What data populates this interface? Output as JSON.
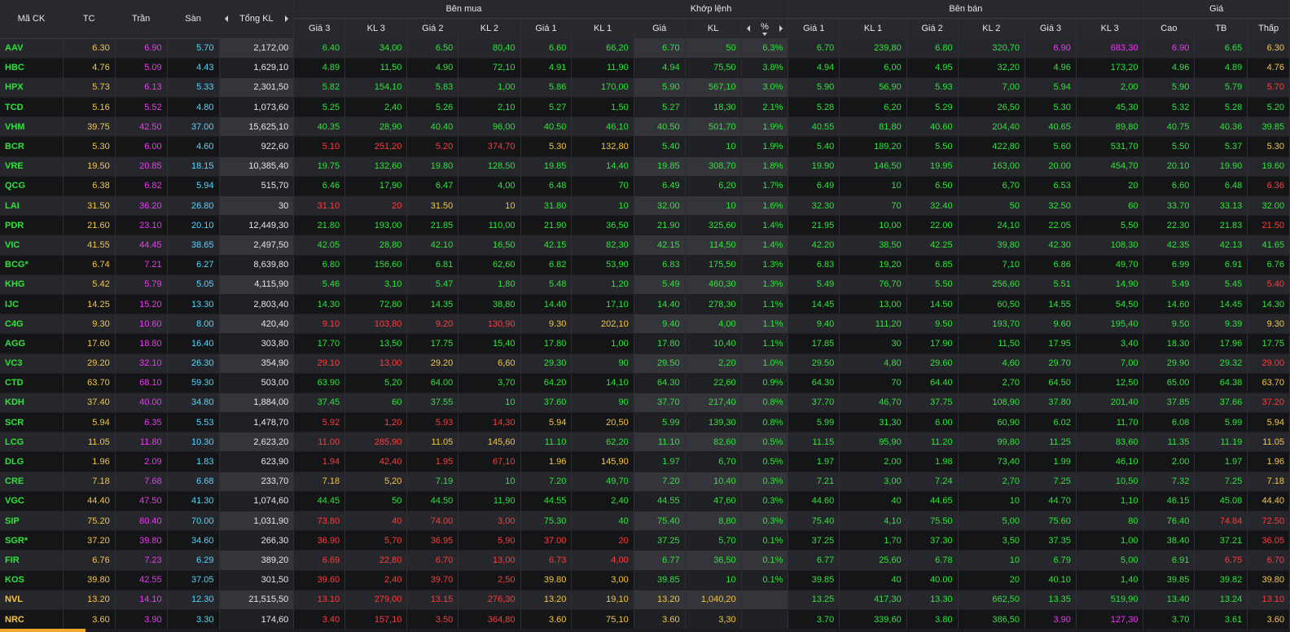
{
  "header": {
    "symbol": "Mã CK",
    "ref": "TC",
    "ceil": "Trần",
    "floor": "Sàn",
    "total_vol": "Tổng KL",
    "buy_group": "Bên mua",
    "match_group": "Khớp lệnh",
    "sell_group": "Bên bán",
    "price_group": "Giá",
    "buy_cols": [
      "Giá 3",
      "KL 3",
      "Giá 2",
      "KL 2",
      "Giá 1",
      "KL 1"
    ],
    "match_cols": [
      "Giá",
      "KL",
      "%"
    ],
    "sell_cols": [
      "Giá 1",
      "KL 1",
      "Giá 2",
      "KL 2",
      "Giá 3",
      "KL 3"
    ],
    "price_cols": [
      "Cao",
      "TB",
      "Thấp"
    ]
  },
  "colors": {
    "up": "#2fe33a",
    "ref": "#f5c542",
    "down": "#ff3b3b",
    "ceiling": "#f037f5",
    "floor": "#4fd6ff",
    "accent": "#f0a830"
  },
  "rows": [
    {
      "symbol": "AAV",
      "ref": "6.30",
      "ceil": "6.90",
      "floor": "5.70",
      "total_vol": "2,172,00",
      "b3p": "6.40",
      "b3v": "34,00",
      "b2p": "6.50",
      "b2v": "80,40",
      "b1p": "6.60",
      "b1v": "66,20",
      "mp": "6.70",
      "mv": "50",
      "pct": "6.3%",
      "s1p": "6.70",
      "s1v": "239,80",
      "s2p": "6.80",
      "s2v": "320,70",
      "s3p": "6.90",
      "s3v": "683,30",
      "high": "6.90",
      "avg": "6.65",
      "low": "6.30"
    },
    {
      "symbol": "HBC",
      "ref": "4.76",
      "ceil": "5.09",
      "floor": "4.43",
      "total_vol": "1,629,10",
      "b3p": "4.89",
      "b3v": "11,50",
      "b2p": "4.90",
      "b2v": "72,10",
      "b1p": "4.91",
      "b1v": "11,90",
      "mp": "4.94",
      "mv": "75,50",
      "pct": "3.8%",
      "s1p": "4.94",
      "s1v": "6,00",
      "s2p": "4.95",
      "s2v": "32,20",
      "s3p": "4.96",
      "s3v": "173,20",
      "high": "4.96",
      "avg": "4.89",
      "low": "4.76"
    },
    {
      "symbol": "HPX",
      "ref": "5.73",
      "ceil": "6.13",
      "floor": "5.33",
      "total_vol": "2,301,50",
      "b3p": "5.82",
      "b3v": "154,10",
      "b2p": "5.83",
      "b2v": "1,00",
      "b1p": "5.86",
      "b1v": "170,00",
      "mp": "5.90",
      "mv": "567,10",
      "pct": "3.0%",
      "s1p": "5.90",
      "s1v": "56,90",
      "s2p": "5.93",
      "s2v": "7,00",
      "s3p": "5.94",
      "s3v": "2,00",
      "high": "5.90",
      "avg": "5.79",
      "low": "5.70"
    },
    {
      "symbol": "TCD",
      "ref": "5.16",
      "ceil": "5.52",
      "floor": "4.80",
      "total_vol": "1,073,60",
      "b3p": "5.25",
      "b3v": "2,40",
      "b2p": "5.26",
      "b2v": "2,10",
      "b1p": "5.27",
      "b1v": "1,50",
      "mp": "5.27",
      "mv": "18,30",
      "pct": "2.1%",
      "s1p": "5.28",
      "s1v": "6,20",
      "s2p": "5.29",
      "s2v": "26,50",
      "s3p": "5.30",
      "s3v": "45,30",
      "high": "5.32",
      "avg": "5.28",
      "low": "5.20"
    },
    {
      "symbol": "VHM",
      "ref": "39.75",
      "ceil": "42.50",
      "floor": "37.00",
      "total_vol": "15,625,10",
      "b3p": "40.35",
      "b3v": "28,90",
      "b2p": "40.40",
      "b2v": "96,00",
      "b1p": "40.50",
      "b1v": "46,10",
      "mp": "40.50",
      "mv": "501,70",
      "pct": "1.9%",
      "s1p": "40.55",
      "s1v": "81,80",
      "s2p": "40.60",
      "s2v": "204,40",
      "s3p": "40.65",
      "s3v": "89,80",
      "high": "40.75",
      "avg": "40.36",
      "low": "39.85"
    },
    {
      "symbol": "BCR",
      "ref": "5.30",
      "ceil": "6.00",
      "floor": "4.60",
      "total_vol": "922,60",
      "b3p": "5.10",
      "b3v": "251,20",
      "b2p": "5.20",
      "b2v": "374,70",
      "b1p": "5.30",
      "b1v": "132,80",
      "mp": "5.40",
      "mv": "10",
      "pct": "1.9%",
      "s1p": "5.40",
      "s1v": "189,20",
      "s2p": "5.50",
      "s2v": "422,80",
      "s3p": "5.60",
      "s3v": "531,70",
      "high": "5.50",
      "avg": "5.37",
      "low": "5.30"
    },
    {
      "symbol": "VRE",
      "ref": "19.50",
      "ceil": "20.85",
      "floor": "18.15",
      "total_vol": "10,385,40",
      "b3p": "19.75",
      "b3v": "132,60",
      "b2p": "19.80",
      "b2v": "128,50",
      "b1p": "19.85",
      "b1v": "14,40",
      "mp": "19.85",
      "mv": "308,70",
      "pct": "1.8%",
      "s1p": "19.90",
      "s1v": "146,50",
      "s2p": "19.95",
      "s2v": "163,00",
      "s3p": "20.00",
      "s3v": "454,70",
      "high": "20.10",
      "avg": "19.90",
      "low": "19.60"
    },
    {
      "symbol": "QCG",
      "ref": "6.38",
      "ceil": "6.82",
      "floor": "5.94",
      "total_vol": "515,70",
      "b3p": "6.46",
      "b3v": "17,90",
      "b2p": "6.47",
      "b2v": "4,00",
      "b1p": "6.48",
      "b1v": "70",
      "mp": "6.49",
      "mv": "6,20",
      "pct": "1.7%",
      "s1p": "6.49",
      "s1v": "10",
      "s2p": "6.50",
      "s2v": "6,70",
      "s3p": "6.53",
      "s3v": "20",
      "high": "6.60",
      "avg": "6.48",
      "low": "6.36"
    },
    {
      "symbol": "LAI",
      "ref": "31.50",
      "ceil": "36.20",
      "floor": "26.80",
      "total_vol": "30",
      "b3p": "31.10",
      "b3v": "20",
      "b2p": "31.50",
      "b2v": "10",
      "b1p": "31.80",
      "b1v": "10",
      "mp": "32.00",
      "mv": "10",
      "pct": "1.6%",
      "s1p": "32.30",
      "s1v": "70",
      "s2p": "32.40",
      "s2v": "50",
      "s3p": "32.50",
      "s3v": "60",
      "high": "33.70",
      "avg": "33.13",
      "low": "32.00"
    },
    {
      "symbol": "PDR",
      "ref": "21.60",
      "ceil": "23.10",
      "floor": "20.10",
      "total_vol": "12,449,30",
      "b3p": "21.80",
      "b3v": "193,00",
      "b2p": "21.85",
      "b2v": "110,00",
      "b1p": "21.90",
      "b1v": "36,50",
      "mp": "21.90",
      "mv": "325,60",
      "pct": "1.4%",
      "s1p": "21.95",
      "s1v": "10,00",
      "s2p": "22.00",
      "s2v": "24,10",
      "s3p": "22.05",
      "s3v": "5,50",
      "high": "22.30",
      "avg": "21.83",
      "low": "21.50"
    },
    {
      "symbol": "VIC",
      "ref": "41.55",
      "ceil": "44.45",
      "floor": "38.65",
      "total_vol": "2,497,50",
      "b3p": "42.05",
      "b3v": "28,80",
      "b2p": "42.10",
      "b2v": "16,50",
      "b1p": "42.15",
      "b1v": "82,30",
      "mp": "42.15",
      "mv": "114,50",
      "pct": "1.4%",
      "s1p": "42.20",
      "s1v": "38,50",
      "s2p": "42.25",
      "s2v": "39,80",
      "s3p": "42.30",
      "s3v": "108,30",
      "high": "42.35",
      "avg": "42.13",
      "low": "41.65"
    },
    {
      "symbol": "BCG*",
      "ref": "6.74",
      "ceil": "7.21",
      "floor": "6.27",
      "total_vol": "8,639,80",
      "b3p": "6.80",
      "b3v": "156,60",
      "b2p": "6.81",
      "b2v": "62,60",
      "b1p": "6.82",
      "b1v": "53,90",
      "mp": "6.83",
      "mv": "175,50",
      "pct": "1.3%",
      "s1p": "6.83",
      "s1v": "19,20",
      "s2p": "6.85",
      "s2v": "7,10",
      "s3p": "6.86",
      "s3v": "49,70",
      "high": "6.99",
      "avg": "6.91",
      "low": "6.76"
    },
    {
      "symbol": "KHG",
      "ref": "5.42",
      "ceil": "5.79",
      "floor": "5.05",
      "total_vol": "4,115,90",
      "b3p": "5.46",
      "b3v": "3,10",
      "b2p": "5.47",
      "b2v": "1,80",
      "b1p": "5.48",
      "b1v": "1,20",
      "mp": "5.49",
      "mv": "460,30",
      "pct": "1.3%",
      "s1p": "5.49",
      "s1v": "76,70",
      "s2p": "5.50",
      "s2v": "256,60",
      "s3p": "5.51",
      "s3v": "14,90",
      "high": "5.49",
      "avg": "5.45",
      "low": "5.40"
    },
    {
      "symbol": "IJC",
      "ref": "14.25",
      "ceil": "15.20",
      "floor": "13.30",
      "total_vol": "2,803,40",
      "b3p": "14.30",
      "b3v": "72,80",
      "b2p": "14.35",
      "b2v": "38,80",
      "b1p": "14.40",
      "b1v": "17,10",
      "mp": "14.40",
      "mv": "278,30",
      "pct": "1.1%",
      "s1p": "14.45",
      "s1v": "13,00",
      "s2p": "14.50",
      "s2v": "60,50",
      "s3p": "14.55",
      "s3v": "54,50",
      "high": "14.60",
      "avg": "14.45",
      "low": "14.30"
    },
    {
      "symbol": "C4G",
      "ref": "9.30",
      "ceil": "10.60",
      "floor": "8.00",
      "total_vol": "420,40",
      "b3p": "9.10",
      "b3v": "103,80",
      "b2p": "9.20",
      "b2v": "130,90",
      "b1p": "9.30",
      "b1v": "202,10",
      "mp": "9.40",
      "mv": "4,00",
      "pct": "1.1%",
      "s1p": "9.40",
      "s1v": "111,20",
      "s2p": "9.50",
      "s2v": "193,70",
      "s3p": "9.60",
      "s3v": "195,40",
      "high": "9.50",
      "avg": "9.39",
      "low": "9.30"
    },
    {
      "symbol": "AGG",
      "ref": "17.60",
      "ceil": "18.80",
      "floor": "16.40",
      "total_vol": "303,80",
      "b3p": "17.70",
      "b3v": "13,50",
      "b2p": "17.75",
      "b2v": "15,40",
      "b1p": "17.80",
      "b1v": "1,00",
      "mp": "17.80",
      "mv": "10,40",
      "pct": "1.1%",
      "s1p": "17.85",
      "s1v": "30",
      "s2p": "17.90",
      "s2v": "11,50",
      "s3p": "17.95",
      "s3v": "3,40",
      "high": "18.30",
      "avg": "17.96",
      "low": "17.75"
    },
    {
      "symbol": "VC3",
      "ref": "29.20",
      "ceil": "32.10",
      "floor": "26.30",
      "total_vol": "354,90",
      "b3p": "29.10",
      "b3v": "13,00",
      "b2p": "29.20",
      "b2v": "6,60",
      "b1p": "29.30",
      "b1v": "90",
      "mp": "29.50",
      "mv": "2,20",
      "pct": "1.0%",
      "s1p": "29.50",
      "s1v": "4,80",
      "s2p": "29.60",
      "s2v": "4,60",
      "s3p": "29.70",
      "s3v": "7,00",
      "high": "29.90",
      "avg": "29.32",
      "low": "29.00"
    },
    {
      "symbol": "CTD",
      "ref": "63.70",
      "ceil": "68.10",
      "floor": "59.30",
      "total_vol": "503,00",
      "b3p": "63.90",
      "b3v": "5,20",
      "b2p": "64.00",
      "b2v": "3,70",
      "b1p": "64.20",
      "b1v": "14,10",
      "mp": "64.30",
      "mv": "22,60",
      "pct": "0.9%",
      "s1p": "64.30",
      "s1v": "70",
      "s2p": "64.40",
      "s2v": "2,70",
      "s3p": "64.50",
      "s3v": "12,50",
      "high": "65.00",
      "avg": "64.38",
      "low": "63.70"
    },
    {
      "symbol": "KDH",
      "ref": "37.40",
      "ceil": "40.00",
      "floor": "34.80",
      "total_vol": "1,884,00",
      "b3p": "37.45",
      "b3v": "60",
      "b2p": "37.55",
      "b2v": "10",
      "b1p": "37.60",
      "b1v": "90",
      "mp": "37.70",
      "mv": "217,40",
      "pct": "0.8%",
      "s1p": "37.70",
      "s1v": "46,70",
      "s2p": "37.75",
      "s2v": "108,90",
      "s3p": "37.80",
      "s3v": "201,40",
      "high": "37.85",
      "avg": "37.66",
      "low": "37.20"
    },
    {
      "symbol": "SCR",
      "ref": "5.94",
      "ceil": "6.35",
      "floor": "5.53",
      "total_vol": "1,478,70",
      "b3p": "5.92",
      "b3v": "1,20",
      "b2p": "5.93",
      "b2v": "14,30",
      "b1p": "5.94",
      "b1v": "20,50",
      "mp": "5.99",
      "mv": "139,30",
      "pct": "0.8%",
      "s1p": "5.99",
      "s1v": "31,30",
      "s2p": "6.00",
      "s2v": "60,90",
      "s3p": "6.02",
      "s3v": "11,70",
      "high": "6.08",
      "avg": "5.99",
      "low": "5.94"
    },
    {
      "symbol": "LCG",
      "ref": "11.05",
      "ceil": "11.80",
      "floor": "10.30",
      "total_vol": "2,623,20",
      "b3p": "11.00",
      "b3v": "285,90",
      "b2p": "11.05",
      "b2v": "145,60",
      "b1p": "11.10",
      "b1v": "62,20",
      "mp": "11.10",
      "mv": "82,60",
      "pct": "0.5%",
      "s1p": "11.15",
      "s1v": "95,90",
      "s2p": "11.20",
      "s2v": "99,80",
      "s3p": "11.25",
      "s3v": "83,60",
      "high": "11.35",
      "avg": "11.19",
      "low": "11.05"
    },
    {
      "symbol": "DLG",
      "ref": "1.96",
      "ceil": "2.09",
      "floor": "1.83",
      "total_vol": "623,90",
      "b3p": "1.94",
      "b3v": "42,40",
      "b2p": "1.95",
      "b2v": "67,10",
      "b1p": "1.96",
      "b1v": "145,90",
      "mp": "1.97",
      "mv": "6,70",
      "pct": "0.5%",
      "s1p": "1.97",
      "s1v": "2,00",
      "s2p": "1.98",
      "s2v": "73,40",
      "s3p": "1.99",
      "s3v": "46,10",
      "high": "2.00",
      "avg": "1.97",
      "low": "1.96"
    },
    {
      "symbol": "CRE",
      "ref": "7.18",
      "ceil": "7.68",
      "floor": "6.68",
      "total_vol": "233,70",
      "b3p": "7.18",
      "b3v": "5,20",
      "b2p": "7.19",
      "b2v": "10",
      "b1p": "7.20",
      "b1v": "49,70",
      "mp": "7.20",
      "mv": "10,40",
      "pct": "0.3%",
      "s1p": "7.21",
      "s1v": "3,00",
      "s2p": "7.24",
      "s2v": "2,70",
      "s3p": "7.25",
      "s3v": "10,50",
      "high": "7.32",
      "avg": "7.25",
      "low": "7.18"
    },
    {
      "symbol": "VGC",
      "ref": "44.40",
      "ceil": "47.50",
      "floor": "41.30",
      "total_vol": "1,074,60",
      "b3p": "44.45",
      "b3v": "50",
      "b2p": "44.50",
      "b2v": "11,90",
      "b1p": "44.55",
      "b1v": "2,40",
      "mp": "44.55",
      "mv": "47,60",
      "pct": "0.3%",
      "s1p": "44.60",
      "s1v": "40",
      "s2p": "44.65",
      "s2v": "10",
      "s3p": "44.70",
      "s3v": "1,10",
      "high": "46.15",
      "avg": "45.08",
      "low": "44.40"
    },
    {
      "symbol": "SIP",
      "ref": "75.20",
      "ceil": "80.40",
      "floor": "70.00",
      "total_vol": "1,031,90",
      "b3p": "73.80",
      "b3v": "40",
      "b2p": "74.00",
      "b2v": "3,00",
      "b1p": "75.30",
      "b1v": "40",
      "mp": "75.40",
      "mv": "8,80",
      "pct": "0.3%",
      "s1p": "75.40",
      "s1v": "4,10",
      "s2p": "75.50",
      "s2v": "5,00",
      "s3p": "75.60",
      "s3v": "80",
      "high": "76.40",
      "avg": "74.84",
      "low": "72.50"
    },
    {
      "symbol": "SGR*",
      "ref": "37.20",
      "ceil": "39.80",
      "floor": "34.60",
      "total_vol": "266,30",
      "b3p": "36.90",
      "b3v": "5,70",
      "b2p": "36.95",
      "b2v": "5,90",
      "b1p": "37.00",
      "b1v": "20",
      "mp": "37.25",
      "mv": "5,70",
      "pct": "0.1%",
      "s1p": "37.25",
      "s1v": "1,70",
      "s2p": "37.30",
      "s2v": "3,50",
      "s3p": "37.35",
      "s3v": "1,00",
      "high": "38.40",
      "avg": "37.21",
      "low": "36.05"
    },
    {
      "symbol": "FIR",
      "ref": "6.76",
      "ceil": "7.23",
      "floor": "6.29",
      "total_vol": "389,20",
      "b3p": "6.69",
      "b3v": "22,80",
      "b2p": "6.70",
      "b2v": "13,00",
      "b1p": "6.73",
      "b1v": "4,00",
      "mp": "6.77",
      "mv": "36,50",
      "pct": "0.1%",
      "s1p": "6.77",
      "s1v": "25,60",
      "s2p": "6.78",
      "s2v": "10",
      "s3p": "6.79",
      "s3v": "5,00",
      "high": "6.91",
      "avg": "6.75",
      "low": "6.70"
    },
    {
      "symbol": "KOS",
      "ref": "39.80",
      "ceil": "42.55",
      "floor": "37.05",
      "total_vol": "301,50",
      "b3p": "39.60",
      "b3v": "2,40",
      "b2p": "39.70",
      "b2v": "2,50",
      "b1p": "39.80",
      "b1v": "3,00",
      "mp": "39.85",
      "mv": "10",
      "pct": "0.1%",
      "s1p": "39.85",
      "s1v": "40",
      "s2p": "40.00",
      "s2v": "20",
      "s3p": "40.10",
      "s3v": "1,40",
      "high": "39.85",
      "avg": "39.82",
      "low": "39.80"
    },
    {
      "symbol": "NVL",
      "ref": "13.20",
      "ceil": "14.10",
      "floor": "12.30",
      "total_vol": "21,515,50",
      "b3p": "13.10",
      "b3v": "279,00",
      "b2p": "13.15",
      "b2v": "276,30",
      "b1p": "13.20",
      "b1v": "19,10",
      "mp": "13.20",
      "mv": "1,040,20",
      "pct": "",
      "s1p": "13.25",
      "s1v": "417,30",
      "s2p": "13.30",
      "s2v": "662,50",
      "s3p": "13.35",
      "s3v": "519,90",
      "high": "13.40",
      "avg": "13.24",
      "low": "13.10"
    },
    {
      "symbol": "NRC",
      "ref": "3.60",
      "ceil": "3.90",
      "floor": "3.30",
      "total_vol": "174,60",
      "b3p": "3.40",
      "b3v": "157,10",
      "b2p": "3.50",
      "b2v": "364,80",
      "b1p": "3.60",
      "b1v": "75,10",
      "mp": "3.60",
      "mv": "3,30",
      "pct": "",
      "s1p": "3.70",
      "s1v": "339,60",
      "s2p": "3.80",
      "s2v": "386,50",
      "s3p": "3.90",
      "s3v": "127,30",
      "high": "3.70",
      "avg": "3.61",
      "low": "3.60"
    }
  ]
}
